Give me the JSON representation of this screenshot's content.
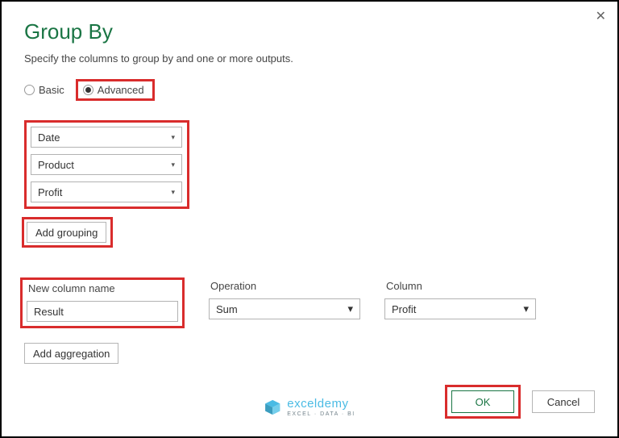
{
  "dialog": {
    "title": "Group By",
    "subtitle": "Specify the columns to group by and one or more outputs."
  },
  "mode": {
    "basic_label": "Basic",
    "advanced_label": "Advanced",
    "selected": "Advanced"
  },
  "groupings": {
    "fields": [
      "Date",
      "Product",
      "Profit"
    ],
    "add_button": "Add grouping"
  },
  "aggregation": {
    "new_col_label": "New column name",
    "new_col_value": "Result",
    "operation_label": "Operation",
    "operation_value": "Sum",
    "column_label": "Column",
    "column_value": "Profit",
    "add_button": "Add aggregation"
  },
  "footer": {
    "ok": "OK",
    "cancel": "Cancel"
  },
  "watermark": {
    "brand": "exceldemy",
    "tagline": "EXCEL · DATA · BI"
  }
}
